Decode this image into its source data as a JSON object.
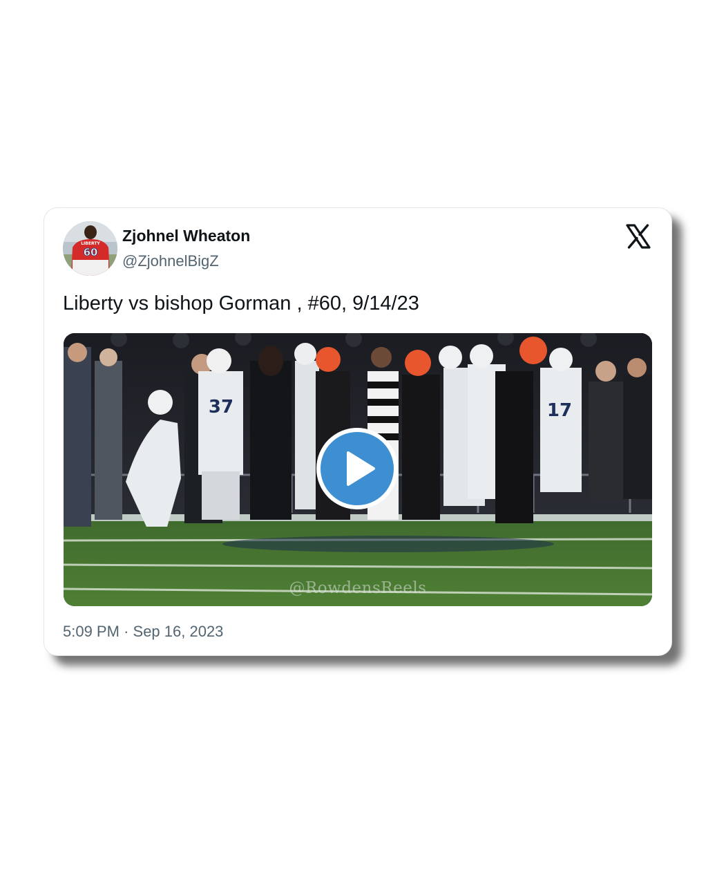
{
  "tweet": {
    "author_name": "Zjohnel Wheaton",
    "author_handle": "@ZjohnelBigZ",
    "text": "Liberty vs bishop Gorman , #60, 9/14/23",
    "time": "5:09 PM",
    "separator": "·",
    "date": "Sep 16, 2023"
  },
  "media": {
    "type": "video",
    "watermark": "@RowdensReels",
    "play_icon": "play-icon"
  },
  "avatar": {
    "jersey_number": "60",
    "jersey_text": "LIBERTY"
  },
  "icons": {
    "platform": "x-logo-icon"
  },
  "colors": {
    "play_button": "#3d8fd1",
    "text_primary": "#0f1419",
    "text_secondary": "#536471",
    "card_border": "#e3e6ea"
  }
}
